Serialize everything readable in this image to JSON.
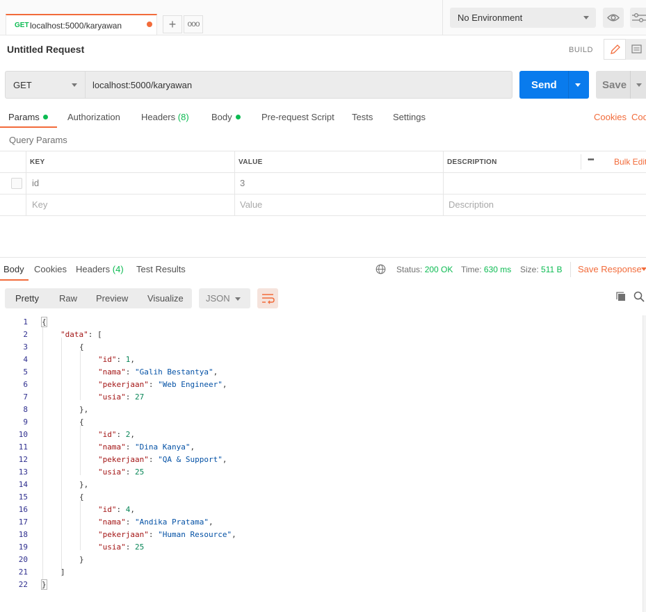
{
  "tab": {
    "method": "GET",
    "url": "localhost:5000/karyawan",
    "new_symbol": "+",
    "more_symbol": "ooo"
  },
  "environment": {
    "selected": "No Environment"
  },
  "request": {
    "title": "Untitled Request",
    "mode": "BUILD",
    "method": "GET",
    "url": "localhost:5000/karyawan",
    "send_label": "Send",
    "save_label": "Save"
  },
  "request_tabs": {
    "params": "Params",
    "authorization": "Authorization",
    "headers": "Headers",
    "headers_count": "(8)",
    "body": "Body",
    "prerequest": "Pre-request Script",
    "tests": "Tests",
    "settings": "Settings",
    "cookies": "Cookies",
    "code": "Code"
  },
  "query_params": {
    "title": "Query Params",
    "columns": {
      "key": "KEY",
      "value": "VALUE",
      "description": "DESCRIPTION"
    },
    "more": "•••",
    "bulk_edit": "Bulk Edit",
    "rows": [
      {
        "key": "id",
        "value": "3",
        "description": ""
      }
    ],
    "placeholder": {
      "key": "Key",
      "value": "Value",
      "description": "Description"
    }
  },
  "response_tabs": {
    "body": "Body",
    "cookies": "Cookies",
    "headers": "Headers",
    "headers_count": "(4)",
    "tests": "Test Results"
  },
  "response_status": {
    "status_label": "Status:",
    "status": "200 OK",
    "time_label": "Time:",
    "time": "630 ms",
    "size_label": "Size:",
    "size": "511 B",
    "save_response": "Save Response"
  },
  "view": {
    "pretty": "Pretty",
    "raw": "Raw",
    "preview": "Preview",
    "visualize": "Visualize",
    "format": "JSON"
  },
  "line_numbers": [
    "1",
    "2",
    "3",
    "4",
    "5",
    "6",
    "7",
    "8",
    "9",
    "10",
    "11",
    "12",
    "13",
    "14",
    "15",
    "16",
    "17",
    "18",
    "19",
    "20",
    "21",
    "22"
  ],
  "json_body": {
    "root_open": "{",
    "data_key": "\"data\"",
    "array_open": ": [",
    "items": [
      {
        "id": "1",
        "nama": "\"Galih Bestantya\"",
        "pekerjaan": "\"Web Engineer\"",
        "usia": "27"
      },
      {
        "id": "2",
        "nama": "\"Dina Kanya\"",
        "pekerjaan": "\"QA & Support\"",
        "usia": "25"
      },
      {
        "id": "4",
        "nama": "\"Andika Pratama\"",
        "pekerjaan": "\"Human Resource\"",
        "usia": "25"
      }
    ],
    "key_id": "\"id\"",
    "key_nama": "\"nama\"",
    "key_pekerjaan": "\"pekerjaan\"",
    "key_usia": "\"usia\"",
    "obj_open": "{",
    "obj_close_comma": "},",
    "obj_close": "}",
    "array_close": "]",
    "root_close": "}"
  },
  "colors": {
    "accent": "#f26b3a",
    "send": "#097bed",
    "success": "#0cbb52"
  }
}
